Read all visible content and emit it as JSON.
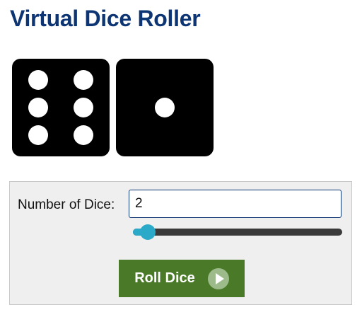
{
  "title": "Virtual Dice Roller",
  "dice": [
    {
      "value": 6,
      "icon": "die-six-icon"
    },
    {
      "value": 1,
      "icon": "die-one-icon"
    }
  ],
  "controls": {
    "number_label": "Number of Dice:",
    "number_value": "2",
    "slider_value": 2,
    "slider_min": 1,
    "slider_max": 100,
    "roll_label": "Roll Dice",
    "roll_icon": "play-circle-icon"
  },
  "colors": {
    "title": "#0d3573",
    "die": "#000000",
    "button": "#4a7a28",
    "slider_accent": "#2aa9c9"
  }
}
